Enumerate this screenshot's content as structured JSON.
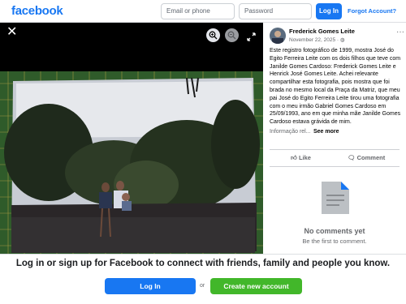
{
  "header": {
    "logo": "facebook",
    "email_placeholder": "Email or phone",
    "password_placeholder": "Password",
    "login_label": "Log In",
    "forgot_label": "Forgot Account?"
  },
  "viewer": {
    "controls": [
      "close-icon",
      "zoom-in-icon",
      "zoom-out-icon",
      "fullscreen-icon"
    ]
  },
  "post": {
    "author": "Frederick Gomes Leite",
    "date": "November 22, 2025",
    "text": "Este registro fotográfico de 1999, mostra José do Egito Ferreira Leite com os dois filhos que teve com Janilde Gomes Cardoso: Frederick Gomes Leite e Henrick José Gomes Leite. Achei relevante compartilhar esta fotografia, pois mostra que foi brada no mesmo local da Praça da Matriz, que meu pai José do Egito Ferreira Leite tirou uma fotografia com o meu irmão Gabriel Gomes Cardoso em 25/09/1993, ano em que minha mãe Janilde Gomes Cardoso estava grávida de mim.",
    "info_label": "Informação rel...",
    "see_more": "See more",
    "like_label": "Like",
    "comment_label": "Comment",
    "no_comments": "No comments yet",
    "first_to_comment": "Be the first to comment."
  },
  "footer": {
    "cta": "Log in or sign up for Facebook to connect with friends, family and people you know.",
    "login_label": "Log In",
    "or": "or",
    "create_label": "Create new account"
  },
  "colors": {
    "brand": "#1877f2",
    "create": "#42b72a"
  }
}
